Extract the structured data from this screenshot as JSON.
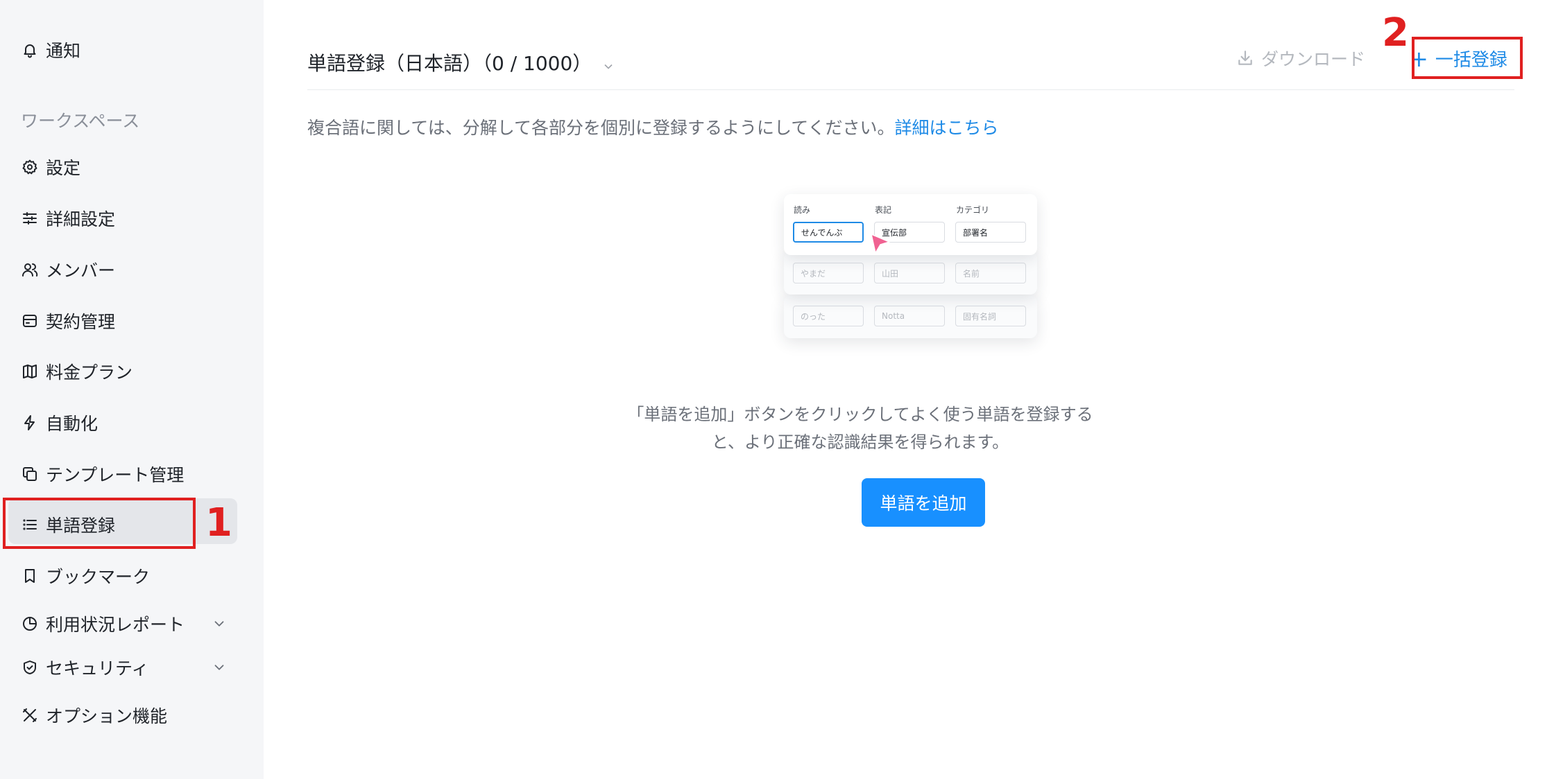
{
  "sidebar": {
    "notification": "通知",
    "section_label": "ワークスペース",
    "items": [
      {
        "label": "設定",
        "icon": "gear-icon"
      },
      {
        "label": "詳細設定",
        "icon": "sliders-icon"
      },
      {
        "label": "メンバー",
        "icon": "users-icon"
      },
      {
        "label": "契約管理",
        "icon": "card-icon"
      },
      {
        "label": "料金プラン",
        "icon": "map-icon"
      },
      {
        "label": "自動化",
        "icon": "bolt-icon"
      },
      {
        "label": "テンプレート管理",
        "icon": "template-icon"
      },
      {
        "label": "単語登録",
        "icon": "list-icon",
        "active": true
      },
      {
        "label": "ブックマーク",
        "icon": "bookmark-icon"
      },
      {
        "label": "利用状況レポート",
        "icon": "pie-chart-icon",
        "expandable": true
      },
      {
        "label": "セキュリティ",
        "icon": "shield-icon",
        "expandable": true
      },
      {
        "label": "オプション機能",
        "icon": "tools-icon"
      }
    ]
  },
  "annotations": {
    "one": "1",
    "two": "2"
  },
  "header": {
    "title": "単語登録（日本語）（0 / 1000）",
    "download_label": "ダウンロード",
    "bulk_label": "一括登録",
    "bulk_plus": "+"
  },
  "notice": {
    "text": "複合語に関しては、分解して各部分を個別に登録するようにしてください。",
    "link": "詳細はこちら"
  },
  "illustration": {
    "headers": [
      "読み",
      "表記",
      "カテゴリ"
    ],
    "rows": [
      [
        "せんでんぶ",
        "宣伝部",
        "部署名"
      ],
      [
        "やまだ",
        "山田",
        "名前"
      ],
      [
        "のった",
        "Notta",
        "固有名詞"
      ]
    ]
  },
  "empty_state": {
    "line1": "「単語を追加」ボタンをクリックしてよく使う単語を登録する",
    "line2": "と、より正確な認識結果を得られます。",
    "button": "単語を追加"
  },
  "colors": {
    "accent": "#1890ff",
    "link": "#1e8ae6",
    "annotation": "#e02020",
    "sidebar_bg": "#f5f6f8"
  }
}
